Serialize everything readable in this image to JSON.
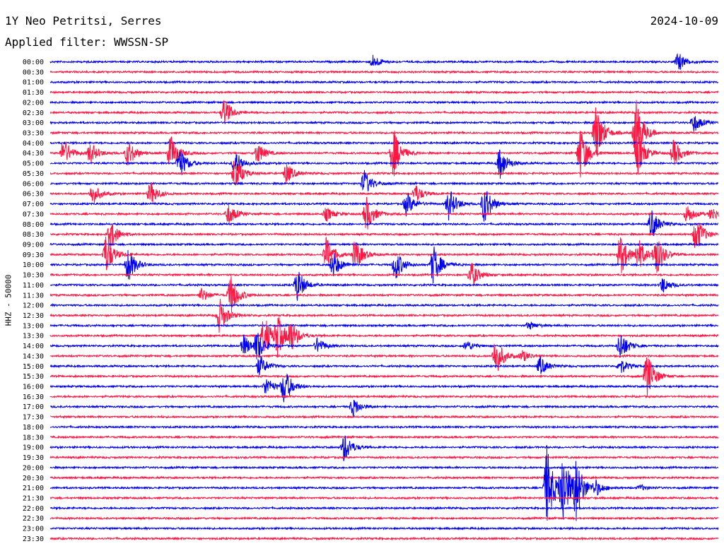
{
  "header": {
    "station": "1Y Neo Petritsi, Serres",
    "date": "2024-10-09",
    "filter": "Applied filter: WWSSN-SP"
  },
  "chart_data": {
    "type": "line",
    "channel_label": "HHZ - 50000",
    "x_range_minutes": [
      0,
      30
    ],
    "colors": [
      "#0000ee",
      "#ff1744"
    ],
    "y_tick_labels": [
      "00:00",
      "00:30",
      "01:00",
      "01:30",
      "02:00",
      "02:30",
      "03:00",
      "03:30",
      "04:00",
      "04:30",
      "05:00",
      "05:30",
      "06:00",
      "06:30",
      "07:00",
      "07:30",
      "08:00",
      "08:30",
      "09:00",
      "09:30",
      "10:00",
      "10:30",
      "11:00",
      "11:30",
      "12:00",
      "12:30",
      "13:00",
      "13:30",
      "14:00",
      "14:30",
      "15:00",
      "15:30",
      "16:00",
      "16:30",
      "17:00",
      "17:30",
      "18:00",
      "18:30",
      "19:00",
      "19:30",
      "20:00",
      "20:30",
      "21:00",
      "21:30",
      "22:00",
      "22:30",
      "23:00",
      "23:30"
    ],
    "events": [
      {
        "row": 0,
        "minute": 14.5,
        "amplitude": 10
      },
      {
        "row": 0,
        "minute": 28.2,
        "amplitude": 14
      },
      {
        "row": 5,
        "minute": 7.8,
        "amplitude": 22
      },
      {
        "row": 6,
        "minute": 28.9,
        "amplitude": 14
      },
      {
        "row": 7,
        "minute": 24.5,
        "amplitude": 44
      },
      {
        "row": 7,
        "minute": 26.3,
        "amplitude": 50
      },
      {
        "row": 9,
        "minute": 0.6,
        "amplitude": 22
      },
      {
        "row": 9,
        "minute": 1.8,
        "amplitude": 16
      },
      {
        "row": 9,
        "minute": 3.5,
        "amplitude": 20
      },
      {
        "row": 9,
        "minute": 5.4,
        "amplitude": 28
      },
      {
        "row": 9,
        "minute": 9.3,
        "amplitude": 16
      },
      {
        "row": 9,
        "minute": 15.4,
        "amplitude": 38
      },
      {
        "row": 9,
        "minute": 23.8,
        "amplitude": 40
      },
      {
        "row": 9,
        "minute": 26.4,
        "amplitude": 30
      },
      {
        "row": 9,
        "minute": 28.0,
        "amplitude": 20
      },
      {
        "row": 10,
        "minute": 5.8,
        "amplitude": 24
      },
      {
        "row": 10,
        "minute": 8.3,
        "amplitude": 20
      },
      {
        "row": 10,
        "minute": 20.2,
        "amplitude": 24
      },
      {
        "row": 11,
        "minute": 8.3,
        "amplitude": 26
      },
      {
        "row": 11,
        "minute": 10.6,
        "amplitude": 16
      },
      {
        "row": 12,
        "minute": 14.1,
        "amplitude": 20
      },
      {
        "row": 13,
        "minute": 1.9,
        "amplitude": 16
      },
      {
        "row": 13,
        "minute": 4.5,
        "amplitude": 18
      },
      {
        "row": 13,
        "minute": 16.4,
        "amplitude": 14
      },
      {
        "row": 14,
        "minute": 16.0,
        "amplitude": 18
      },
      {
        "row": 14,
        "minute": 17.9,
        "amplitude": 24
      },
      {
        "row": 14,
        "minute": 19.5,
        "amplitude": 30
      },
      {
        "row": 15,
        "minute": 8.0,
        "amplitude": 16
      },
      {
        "row": 15,
        "minute": 12.4,
        "amplitude": 10
      },
      {
        "row": 15,
        "minute": 14.2,
        "amplitude": 26
      },
      {
        "row": 15,
        "minute": 28.6,
        "amplitude": 14
      },
      {
        "row": 15,
        "minute": 29.7,
        "amplitude": 10
      },
      {
        "row": 16,
        "minute": 27.0,
        "amplitude": 22
      },
      {
        "row": 17,
        "minute": 2.7,
        "amplitude": 22
      },
      {
        "row": 17,
        "minute": 29.0,
        "amplitude": 28
      },
      {
        "row": 19,
        "minute": 2.5,
        "amplitude": 30
      },
      {
        "row": 19,
        "minute": 12.4,
        "amplitude": 26
      },
      {
        "row": 19,
        "minute": 13.7,
        "amplitude": 24
      },
      {
        "row": 19,
        "minute": 25.6,
        "amplitude": 32
      },
      {
        "row": 19,
        "minute": 26.4,
        "amplitude": 22
      },
      {
        "row": 19,
        "minute": 27.2,
        "amplitude": 32
      },
      {
        "row": 20,
        "minute": 3.5,
        "amplitude": 26
      },
      {
        "row": 20,
        "minute": 12.7,
        "amplitude": 20
      },
      {
        "row": 20,
        "minute": 15.5,
        "amplitude": 24
      },
      {
        "row": 20,
        "minute": 17.2,
        "amplitude": 30
      },
      {
        "row": 21,
        "minute": 18.9,
        "amplitude": 20
      },
      {
        "row": 22,
        "minute": 11.1,
        "amplitude": 24
      },
      {
        "row": 22,
        "minute": 27.5,
        "amplitude": 12
      },
      {
        "row": 23,
        "minute": 6.8,
        "amplitude": 10
      },
      {
        "row": 23,
        "minute": 8.1,
        "amplitude": 30
      },
      {
        "row": 25,
        "minute": 7.6,
        "amplitude": 26
      },
      {
        "row": 26,
        "minute": 21.5,
        "amplitude": 6
      },
      {
        "row": 27,
        "minute": 9.6,
        "amplitude": 30
      },
      {
        "row": 27,
        "minute": 10.2,
        "amplitude": 28
      },
      {
        "row": 27,
        "minute": 10.8,
        "amplitude": 22
      },
      {
        "row": 28,
        "minute": 8.7,
        "amplitude": 16
      },
      {
        "row": 28,
        "minute": 9.3,
        "amplitude": 22
      },
      {
        "row": 28,
        "minute": 12.0,
        "amplitude": 12
      },
      {
        "row": 28,
        "minute": 18.7,
        "amplitude": 8
      },
      {
        "row": 28,
        "minute": 25.6,
        "amplitude": 22
      },
      {
        "row": 29,
        "minute": 20.0,
        "amplitude": 30
      },
      {
        "row": 29,
        "minute": 21.2,
        "amplitude": 8
      },
      {
        "row": 30,
        "minute": 9.4,
        "amplitude": 16
      },
      {
        "row": 30,
        "minute": 22.0,
        "amplitude": 14
      },
      {
        "row": 30,
        "minute": 25.6,
        "amplitude": 12
      },
      {
        "row": 31,
        "minute": 26.8,
        "amplitude": 36
      },
      {
        "row": 32,
        "minute": 9.7,
        "amplitude": 14
      },
      {
        "row": 32,
        "minute": 10.5,
        "amplitude": 28
      },
      {
        "row": 34,
        "minute": 13.6,
        "amplitude": 14
      },
      {
        "row": 38,
        "minute": 13.2,
        "amplitude": 22
      },
      {
        "row": 42,
        "minute": 22.3,
        "amplitude": 60
      },
      {
        "row": 42,
        "minute": 23.0,
        "amplitude": 56
      },
      {
        "row": 42,
        "minute": 23.6,
        "amplitude": 44
      },
      {
        "row": 42,
        "minute": 24.5,
        "amplitude": 10
      },
      {
        "row": 42,
        "minute": 26.5,
        "amplitude": 4
      }
    ]
  }
}
